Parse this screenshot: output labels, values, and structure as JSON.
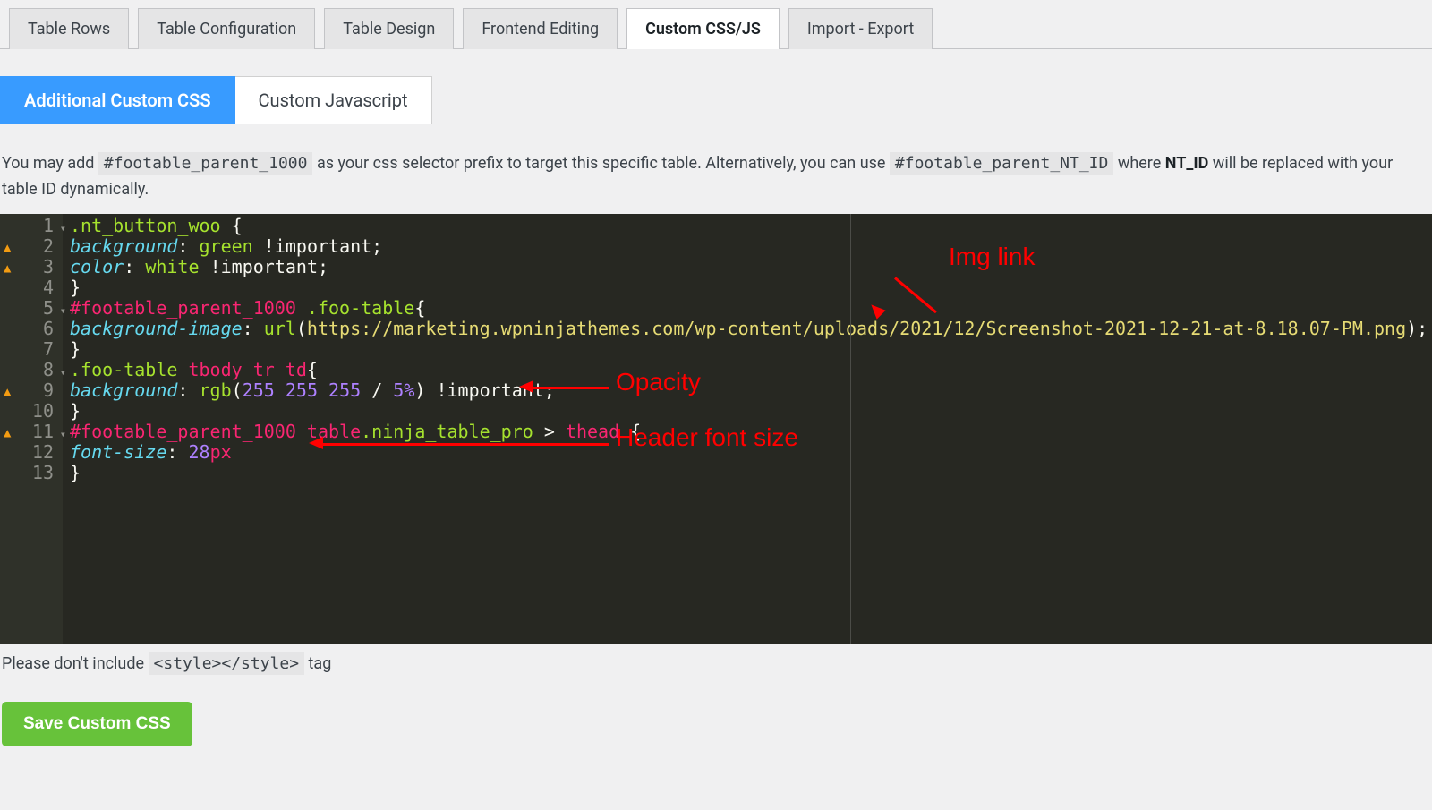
{
  "main_tabs": [
    {
      "label": "Table Rows",
      "active": false
    },
    {
      "label": "Table Configuration",
      "active": false
    },
    {
      "label": "Table Design",
      "active": false
    },
    {
      "label": "Frontend Editing",
      "active": false
    },
    {
      "label": "Custom CSS/JS",
      "active": true
    },
    {
      "label": "Import - Export",
      "active": false
    }
  ],
  "sub_tabs": [
    {
      "label": "Additional Custom CSS",
      "active": true
    },
    {
      "label": "Custom Javascript",
      "active": false
    }
  ],
  "description": {
    "pre": "You may add ",
    "code1": "#footable_parent_1000",
    "mid": " as your css selector prefix to target this specific table. Alternatively, you can use ",
    "code2": "#footable_parent_NT_ID",
    "mid2": " where ",
    "nt_id": "NT_ID",
    "post": " will be replaced with your table ID dynamically."
  },
  "code_lines": [
    {
      "n": 1,
      "warn": false,
      "fold": true,
      "tokens": [
        {
          "t": ".nt_button_woo ",
          "cls": "c-selector"
        },
        {
          "t": "{",
          "cls": "c-punct"
        }
      ]
    },
    {
      "n": 2,
      "warn": true,
      "fold": false,
      "tokens": [
        {
          "t": "background",
          "cls": "c-key"
        },
        {
          "t": ": ",
          "cls": "c-punct"
        },
        {
          "t": "green",
          "cls": "c-val"
        },
        {
          "t": " !important;",
          "cls": "c-punct"
        }
      ]
    },
    {
      "n": 3,
      "warn": true,
      "fold": false,
      "tokens": [
        {
          "t": "color",
          "cls": "c-key"
        },
        {
          "t": ": ",
          "cls": "c-punct"
        },
        {
          "t": "white",
          "cls": "c-val"
        },
        {
          "t": " !important;",
          "cls": "c-punct"
        }
      ]
    },
    {
      "n": 4,
      "warn": false,
      "fold": false,
      "tokens": [
        {
          "t": "}",
          "cls": "c-punct"
        }
      ]
    },
    {
      "n": 5,
      "warn": false,
      "fold": true,
      "tokens": [
        {
          "t": "#footable_parent_1000",
          "cls": "c-selid"
        },
        {
          "t": " ",
          "cls": "c-punct"
        },
        {
          "t": ".foo-table",
          "cls": "c-selector"
        },
        {
          "t": "{",
          "cls": "c-punct"
        }
      ]
    },
    {
      "n": 6,
      "warn": false,
      "fold": false,
      "tokens": [
        {
          "t": "background-image",
          "cls": "c-key"
        },
        {
          "t": ": ",
          "cls": "c-punct"
        },
        {
          "t": "url",
          "cls": "c-val"
        },
        {
          "t": "(",
          "cls": "c-punct"
        },
        {
          "t": "https://marketing.wpninjathemes.com/wp-content/uploads/2021/12/Screenshot-2021-12-21-at-8.18.07-PM.png",
          "cls": "c-url"
        },
        {
          "t": ");",
          "cls": "c-punct"
        }
      ]
    },
    {
      "n": 7,
      "warn": false,
      "fold": false,
      "tokens": [
        {
          "t": "}",
          "cls": "c-punct"
        }
      ]
    },
    {
      "n": 8,
      "warn": false,
      "fold": true,
      "tokens": [
        {
          "t": ".foo-table ",
          "cls": "c-selector"
        },
        {
          "t": "tbody tr td",
          "cls": "c-tag"
        },
        {
          "t": "{",
          "cls": "c-punct"
        }
      ]
    },
    {
      "n": 9,
      "warn": true,
      "fold": false,
      "tokens": [
        {
          "t": "background",
          "cls": "c-key"
        },
        {
          "t": ": ",
          "cls": "c-punct"
        },
        {
          "t": "rgb",
          "cls": "c-val"
        },
        {
          "t": "(",
          "cls": "c-punct"
        },
        {
          "t": "255",
          "cls": "c-purple"
        },
        {
          "t": " ",
          "cls": "c-punct"
        },
        {
          "t": "255",
          "cls": "c-purple"
        },
        {
          "t": " ",
          "cls": "c-punct"
        },
        {
          "t": "255",
          "cls": "c-purple"
        },
        {
          "t": " / ",
          "cls": "c-punct"
        },
        {
          "t": "5%",
          "cls": "c-purple"
        },
        {
          "t": ") !important;",
          "cls": "c-punct"
        }
      ]
    },
    {
      "n": 10,
      "warn": false,
      "fold": false,
      "tokens": [
        {
          "t": "}",
          "cls": "c-punct"
        }
      ]
    },
    {
      "n": 11,
      "warn": true,
      "fold": true,
      "tokens": [
        {
          "t": "#footable_parent_1000",
          "cls": "c-selid"
        },
        {
          "t": " ",
          "cls": "c-punct"
        },
        {
          "t": "table",
          "cls": "c-tag"
        },
        {
          "t": ".ninja_table_pro",
          "cls": "c-selector"
        },
        {
          "t": " > ",
          "cls": "c-punct"
        },
        {
          "t": "thead",
          "cls": "c-tag"
        },
        {
          "t": " {",
          "cls": "c-punct"
        }
      ]
    },
    {
      "n": 12,
      "warn": false,
      "fold": false,
      "tokens": [
        {
          "t": "font-size",
          "cls": "c-key"
        },
        {
          "t": ": ",
          "cls": "c-punct"
        },
        {
          "t": "28",
          "cls": "c-purple"
        },
        {
          "t": "px",
          "cls": "c-tag"
        }
      ]
    },
    {
      "n": 13,
      "warn": false,
      "fold": false,
      "tokens": [
        {
          "t": "}",
          "cls": "c-punct"
        }
      ]
    }
  ],
  "annotations": {
    "img_link": "Img link",
    "opacity": "Opacity",
    "header_font": "Header font size"
  },
  "footer": {
    "pre": "Please don't include ",
    "code": "<style></style>",
    "post": " tag"
  },
  "save_btn": "Save Custom CSS"
}
